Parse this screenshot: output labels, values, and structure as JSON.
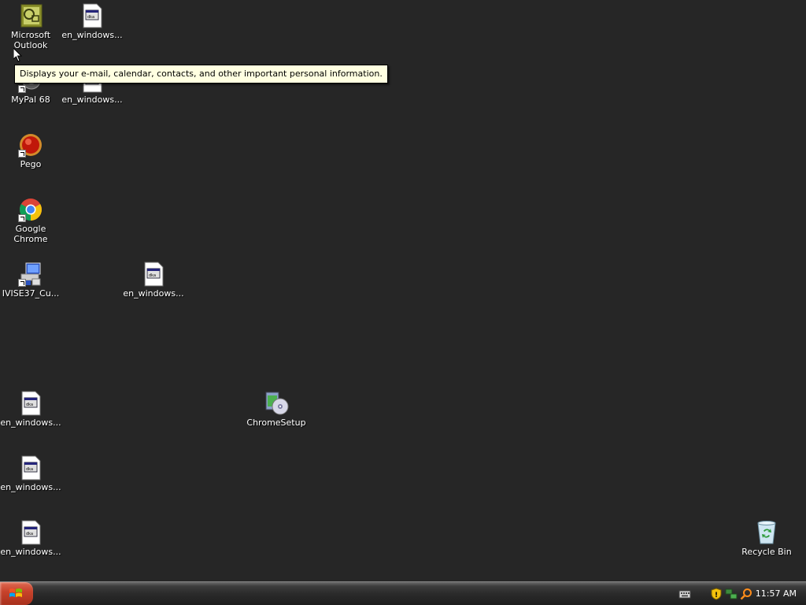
{
  "desktop": {
    "icons": {
      "outlook": "Microsoft Outlook",
      "en_windows_1": "en_windows...",
      "mypal": "MyPal 68",
      "en_windows_2": "en_windows...",
      "pego": "Pego",
      "chrome": "Google Chrome",
      "ivise": "IVISE37_Cu...",
      "en_windows_3": "en_windows...",
      "en_windows_4": "en_windows...",
      "chromesetup": "ChromeSetup",
      "en_windows_5": "en_windows...",
      "en_windows_6": "en_windows...",
      "recycle_bin": "Recycle Bin"
    },
    "icon_names": {
      "outlook": "outlook-icon",
      "document": "document-icon",
      "mypal": "mypal-icon",
      "pego": "pego-icon",
      "chrome": "chrome-icon",
      "installer": "installer-icon",
      "chromesetup": "setup-disc-icon",
      "recycle_bin": "recycle-bin-icon"
    }
  },
  "tooltip": {
    "text": "Displays your e-mail, calendar, contacts, and other important personal information."
  },
  "taskbar": {
    "clock": "11:57 AM",
    "tray_icons": [
      "keyboard-icon",
      "security-shield-icon",
      "network-icon",
      "search-icon"
    ]
  },
  "colors": {
    "desktop_bg": "#262626",
    "start_button": "#c8432c",
    "tooltip_bg": "#ffffe1"
  }
}
